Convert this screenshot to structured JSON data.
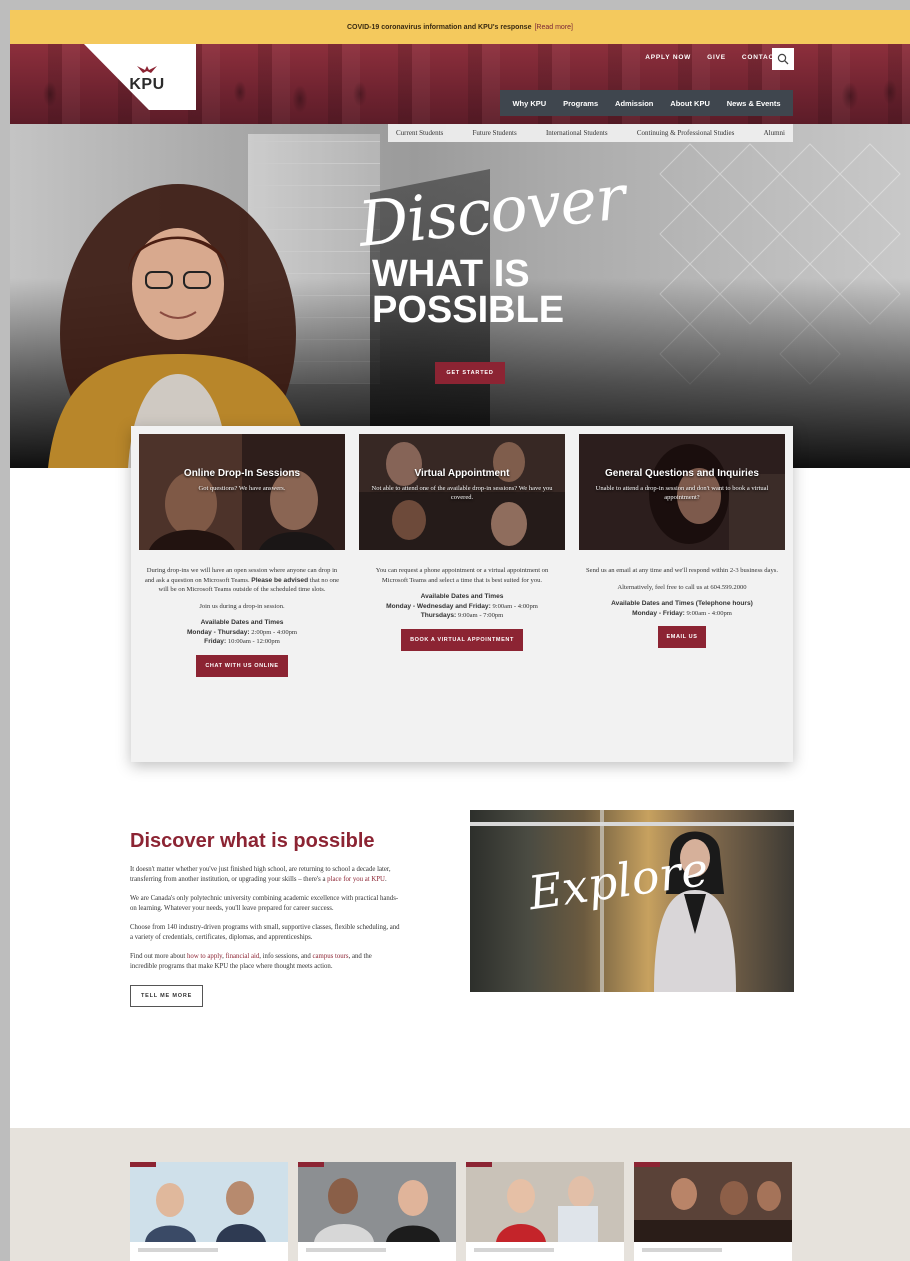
{
  "alert": {
    "text": "COVID-19 coronavirus information and KPU's response",
    "link": "[Read more]"
  },
  "header": {
    "logo_text": "KPU",
    "utility_links": [
      "APPLY NOW",
      "GIVE",
      "CONTACT US"
    ],
    "main_nav": [
      "Why KPU",
      "Programs",
      "Admission",
      "About KPU",
      "News & Events"
    ],
    "audience_nav": [
      "Current Students",
      "Future Students",
      "International Students",
      "Continuing & Professional Studies",
      "Alumni"
    ]
  },
  "hero": {
    "script_word": "Discover",
    "line1": "WHAT IS",
    "line2": "POSSIBLE",
    "cta": "GET STARTED"
  },
  "cards": [
    {
      "title": "Online Drop-In Sessions",
      "subtitle": "Got questions? We have answers.",
      "body_pre": "During drop-ins we will have an open session where anyone can drop in and ask a question on Microsoft Teams. ",
      "body_bold": "Please be advised",
      "body_post": " that no one will be on Microsoft Teams outside of the scheduled time slots.",
      "join": "Join us during a drop-in session.",
      "hours_heading": "Available Dates and Times",
      "hours1_label": "Monday - Thursday:",
      "hours1_value": "2:00pm - 4:00pm",
      "hours2_label": "Friday:",
      "hours2_value": "10:00am - 12:00pm",
      "cta": "CHAT WITH US ONLINE"
    },
    {
      "title": "Virtual Appointment",
      "subtitle": "Not able to attend one of the available drop-in sessions? We have you covered.",
      "body": "You can request a phone appointment or a virtual appointment on Microsoft Teams and select a time that is best suited for you.",
      "hours_heading": "Available Dates and Times",
      "hours1_label": "Monday - Wednesday and Friday:",
      "hours1_value": "9:00am - 4:00pm",
      "hours2_label": "Thursdays:",
      "hours2_value": "9:00am - 7:00pm",
      "cta": "BOOK A VIRTUAL APPOINTMENT"
    },
    {
      "title": "General Questions and Inquiries",
      "subtitle": "Unable to attend a drop-in session and don't want to book a virtual appointment?",
      "body": "Send us an email at any time and we'll respond within 2-3 business days.",
      "alt": "Alternatively, feel free to call us at 604.599.2000",
      "hours_heading": "Available Dates and Times (Telephone hours)",
      "hours1_label": "Monday - Friday:",
      "hours1_value": "9:00am - 4:00pm",
      "cta": "EMAIL US"
    }
  ],
  "discover": {
    "heading": "Discover what is possible",
    "p1_pre": "It doesn't matter whether you've just finished high school, are returning to school a decade later, transferring from another institution, or upgrading your skills – there's a ",
    "p1_link": "place for you at KPU",
    "p1_post": ".",
    "p2": "We are Canada's only polytechnic university combining academic excellence with practical hands-on learning. Whatever your needs, you'll leave prepared for career success.",
    "p3": "Choose from 140 industry-driven programs with small, supportive classes, flexible scheduling, and a variety of credentials, certificates, diplomas, and apprenticeships.",
    "p4_pre": "Find out more about ",
    "p4_link1": "how to apply",
    "p4_sep1": ", ",
    "p4_link2": "financial aid",
    "p4_mid": ", info sessions, and ",
    "p4_link3": "campus tours",
    "p4_post": ", and the incredible programs that make KPU the place where thought meets action.",
    "cta": "TELL ME MORE",
    "image_word": "Explore"
  },
  "colors": {
    "brand": "#8c2433",
    "alert": "#f4c95d",
    "nav": "#3f464e",
    "band": "#e6e2dc"
  },
  "icons": {
    "search": "search-icon",
    "logo": "kpu-bird-icon"
  }
}
